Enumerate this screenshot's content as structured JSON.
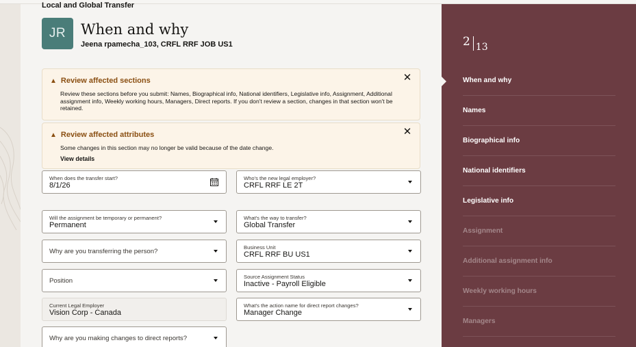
{
  "header": {
    "breadcrumb": "Local and Global Transfer",
    "avatar_initials": "JR",
    "title": "When and why",
    "subtitle": "Jeena rpamecha_103, CRFL RRF JOB US1"
  },
  "messages": [
    {
      "title": "Review affected sections",
      "text": "Review these sections before you submit: Names, Biographical info, National identifiers, Legislative info, Assignment, Additional assignment info, Weekly working hours, Managers, Direct reports. If you don't review a section, changes in that section won't be retained.",
      "close_label": "✕"
    },
    {
      "title": "Review affected attributes",
      "text": "Some changes in this section may no longer be valid because of the date change.",
      "link": "View details",
      "close_label": "✕"
    }
  ],
  "form": {
    "transfer_start": {
      "label": "When does the transfer start?",
      "value": "8/1/26"
    },
    "legal_employer": {
      "label": "Who's the new legal employer?",
      "value": "CRFL RRF LE 2T"
    },
    "assignment_type": {
      "label": "Will the assignment be temporary or permanent?",
      "value": "Permanent"
    },
    "transfer_way": {
      "label": "What's the way to transfer?",
      "value": "Global Transfer"
    },
    "transfer_reason": {
      "placeholder": "Why are you transferring the person?"
    },
    "business_unit": {
      "label": "Business Unit",
      "value": "CRFL RRF BU US1"
    },
    "position": {
      "placeholder": "Position"
    },
    "source_status": {
      "label": "Source Assignment Status",
      "value": "Inactive - Payroll Eligible"
    },
    "current_employer": {
      "label": "Current Legal Employer",
      "value": "Vision Corp - Canada"
    },
    "action_name": {
      "label": "What's the action name for direct report changes?",
      "value": "Manager Change"
    },
    "direct_reports_reason": {
      "placeholder": "Why are you making changes to direct reports?"
    }
  },
  "sidebar": {
    "current_step": "2",
    "total_steps": "13",
    "items": [
      {
        "label": "When and why",
        "enabled": true
      },
      {
        "label": "Names",
        "enabled": true
      },
      {
        "label": "Biographical info",
        "enabled": true
      },
      {
        "label": "National identifiers",
        "enabled": true
      },
      {
        "label": "Legislative info",
        "enabled": true
      },
      {
        "label": "Assignment",
        "enabled": false
      },
      {
        "label": "Additional assignment info",
        "enabled": false
      },
      {
        "label": "Weekly working hours",
        "enabled": false
      },
      {
        "label": "Managers",
        "enabled": false
      }
    ]
  },
  "icons": {
    "warning": "warning-triangle-icon",
    "close": "close-icon",
    "calendar": "calendar-icon",
    "dropdown": "chevron-down-icon"
  },
  "colors": {
    "sidebar_bg": "#6b3c42",
    "avatar_bg": "#4a7d79",
    "warning_text": "#8a4f12",
    "message_bg": "#fcf4e8"
  }
}
